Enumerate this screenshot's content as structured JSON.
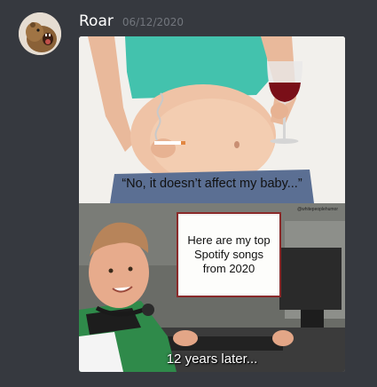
{
  "message": {
    "username": "Roar",
    "timestamp": "06/12/2020",
    "avatar_icon": "capybara-avatar-icon"
  },
  "meme": {
    "top_caption": "“No, it doesn’t affect my baby...”",
    "watermark": "@whitepeoplehumor",
    "sign_text": "Here are my top Spotify songs from 2020",
    "bottom_caption": "12 years later..."
  },
  "colors": {
    "background": "#36393f",
    "username": "#ffffff",
    "timestamp": "#72767d"
  }
}
